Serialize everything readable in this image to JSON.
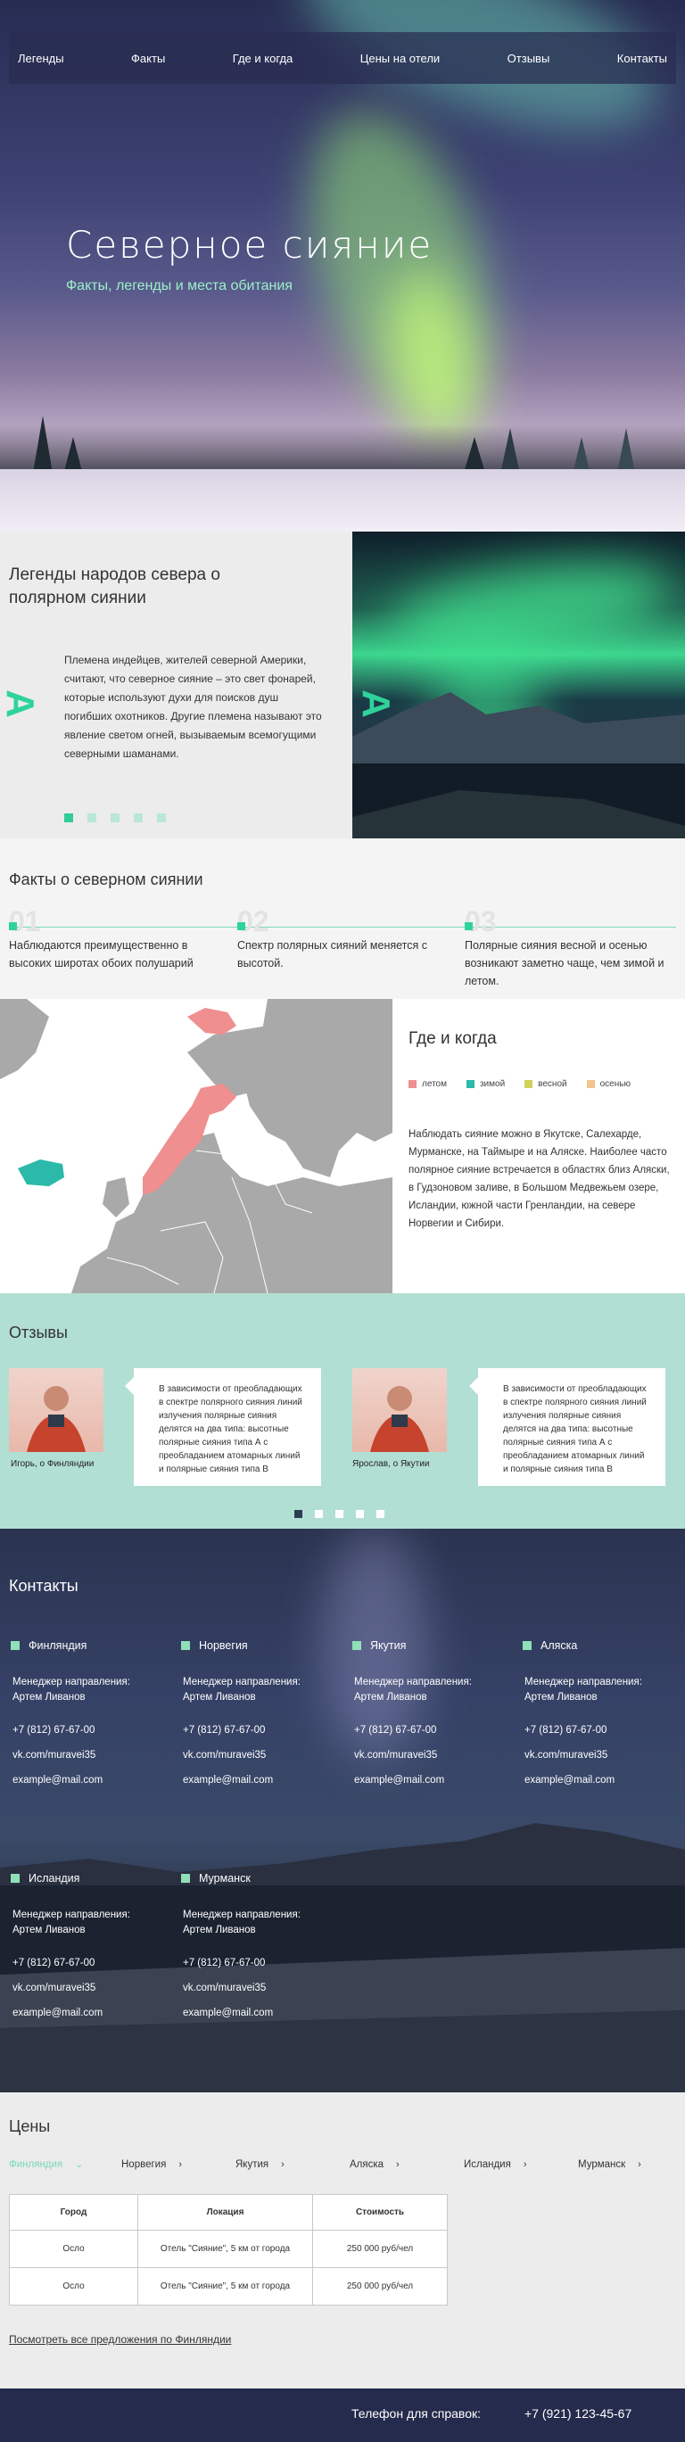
{
  "nav": [
    "Легенды",
    "Факты",
    "Где и когда",
    "Цены на отели",
    "Отзывы",
    "Контакты"
  ],
  "hero": {
    "title": "Северное сияние",
    "subtitle": "Факты, легенды и места обитания"
  },
  "legends": {
    "title": "Легенды народов севера о полярном сиянии",
    "text": "Племена индейцев, жителей северной Америки, считают, что северное сияние – это свет фонарей, которые используют духи для поисков душ погибших охотников. Другие племена называют это явление светом огней, вызываемым всемогущими северными шаманами.",
    "arrow": "A"
  },
  "facts": {
    "title": "Факты о северном сиянии",
    "items": [
      {
        "num": "01",
        "text": "Наблюдаются преимущественно в высоких широтах обоих полушарий"
      },
      {
        "num": "02",
        "text": "Спектр полярных сияний меняется с высотой."
      },
      {
        "num": "03",
        "text": "Полярные сияния весной и осенью возникают заметно чаще, чем зимой и летом."
      }
    ]
  },
  "where": {
    "title": "Где и когда",
    "legend": [
      {
        "label": "летом",
        "color": "#ef8f8f"
      },
      {
        "label": "зимой",
        "color": "#2bb9aa"
      },
      {
        "label": "весной",
        "color": "#cfd35a"
      },
      {
        "label": "осенью",
        "color": "#f2c48a"
      }
    ],
    "text": "Наблюдать сияние можно в Якутске, Салехарде, Мурманске, на Таймыре и на Аляске. Наиболее часто полярное сияние встречается в областях близ Аляски, в Гудзоновом заливе, в Большом Медвежьем озере, Исландии, южной части Гренландии, на севере Норвегии и Сибири."
  },
  "reviews": {
    "title": "Отзывы",
    "items": [
      {
        "name": "Игорь, о Финляндии",
        "text": "В зависимости от преобладающих в спектре полярного сияния линий излучения полярные сияния делятся на два типа: высотные полярные сияния типа А с преобладанием атомарных линий и полярные сияния типа В"
      },
      {
        "name": "Ярослав, о Якутии",
        "text": "В зависимости от преобладающих в спектре полярного сияния линий излучения полярные сияния делятся на два типа: высотные полярные сияния типа А с преобладанием атомарных линий и полярные сияния типа В"
      }
    ]
  },
  "contacts": {
    "title": "Контакты",
    "items": [
      {
        "region": "Финляндия",
        "mgr_label": "Менеджер направления:",
        "mgr": "Артем Ливанов",
        "phone": "+7 (812) 67-67-00",
        "vk": "vk.com/muravei35",
        "email": "example@mail.com"
      },
      {
        "region": "Норвегия",
        "mgr_label": "Менеджер направления:",
        "mgr": "Артем Ливанов",
        "phone": "+7 (812) 67-67-00",
        "vk": "vk.com/muravei35",
        "email": "example@mail.com"
      },
      {
        "region": "Якутия",
        "mgr_label": "Менеджер направления:",
        "mgr": "Артем Ливанов",
        "phone": "+7 (812) 67-67-00",
        "vk": "vk.com/muravei35",
        "email": "example@mail.com"
      },
      {
        "region": "Аляска",
        "mgr_label": "Менеджер направления:",
        "mgr": "Артем Ливанов",
        "phone": "+7 (812) 67-67-00",
        "vk": "vk.com/muravei35",
        "email": "example@mail.com"
      },
      {
        "region": "Исландия",
        "mgr_label": "Менеджер направления:",
        "mgr": "Артем Ливанов",
        "phone": "+7 (812) 67-67-00",
        "vk": "vk.com/muravei35",
        "email": "example@mail.com"
      },
      {
        "region": "Мурманск",
        "mgr_label": "Менеджер направления:",
        "mgr": "Артем Ливанов",
        "phone": "+7 (812) 67-67-00",
        "vk": "vk.com/muravei35",
        "email": "example@mail.com"
      }
    ]
  },
  "prices": {
    "title": "Цены",
    "tabs": [
      "Финляндия",
      "Норвегия",
      "Якутия",
      "Аляска",
      "Исландия",
      "Мурманск"
    ],
    "headers": [
      "Город",
      "Локация",
      "Стоимость"
    ],
    "rows": [
      [
        "Осло",
        "Отель \"Сияние\", 5 км от города",
        "250 000 руб/чел"
      ],
      [
        "Осло",
        "Отель \"Сияние\", 5 км от города",
        "250 000 руб/чел"
      ]
    ],
    "link": "Посмотреть все предложения по Финляндии"
  },
  "footer": {
    "label": "Телефон для справок:",
    "phone": "+7 (921) 123-45-67"
  }
}
